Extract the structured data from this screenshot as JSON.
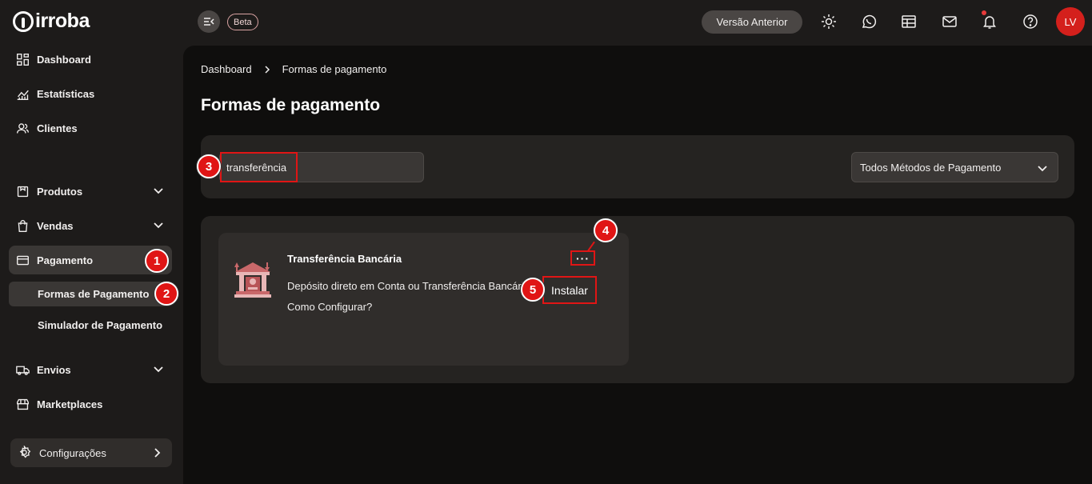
{
  "brand": {
    "name": "irroba"
  },
  "topbar": {
    "beta_label": "Beta",
    "previous_version_label": "Versão Anterior",
    "avatar_initials": "LV"
  },
  "sidebar": {
    "items": [
      {
        "label": "Dashboard",
        "icon": "dashboard-icon"
      },
      {
        "label": "Estatísticas",
        "icon": "chart-icon"
      },
      {
        "label": "Clientes",
        "icon": "users-icon"
      },
      {
        "label": "Produtos",
        "icon": "box-icon"
      },
      {
        "label": "Vendas",
        "icon": "bag-icon"
      },
      {
        "label": "Pagamento",
        "icon": "card-icon"
      },
      {
        "label": "Envios",
        "icon": "truck-icon"
      },
      {
        "label": "Marketplaces",
        "icon": "store-icon"
      }
    ],
    "sub_items": [
      {
        "label": "Formas de Pagamento"
      },
      {
        "label": "Simulador de Pagamento"
      }
    ],
    "config_label": "Configurações"
  },
  "breadcrumb": {
    "root": "Dashboard",
    "current": "Formas de pagamento"
  },
  "page": {
    "title": "Formas de pagamento"
  },
  "filters": {
    "search_value": "transferência",
    "method_select_value": "Todos Métodos de Pagamento"
  },
  "card": {
    "title": "Transferência Bancária",
    "description": "Depósito direto em Conta ou Transferência Bancária",
    "help_link": "Como Configurar?",
    "more_label": "···",
    "install_label": "Instalar"
  },
  "annotations": [
    "1",
    "2",
    "3",
    "4",
    "5"
  ],
  "colors": {
    "accent_red": "#e01515",
    "avatar_red": "#d4201c",
    "panel": "#252321",
    "background": "#0f0e0d"
  }
}
